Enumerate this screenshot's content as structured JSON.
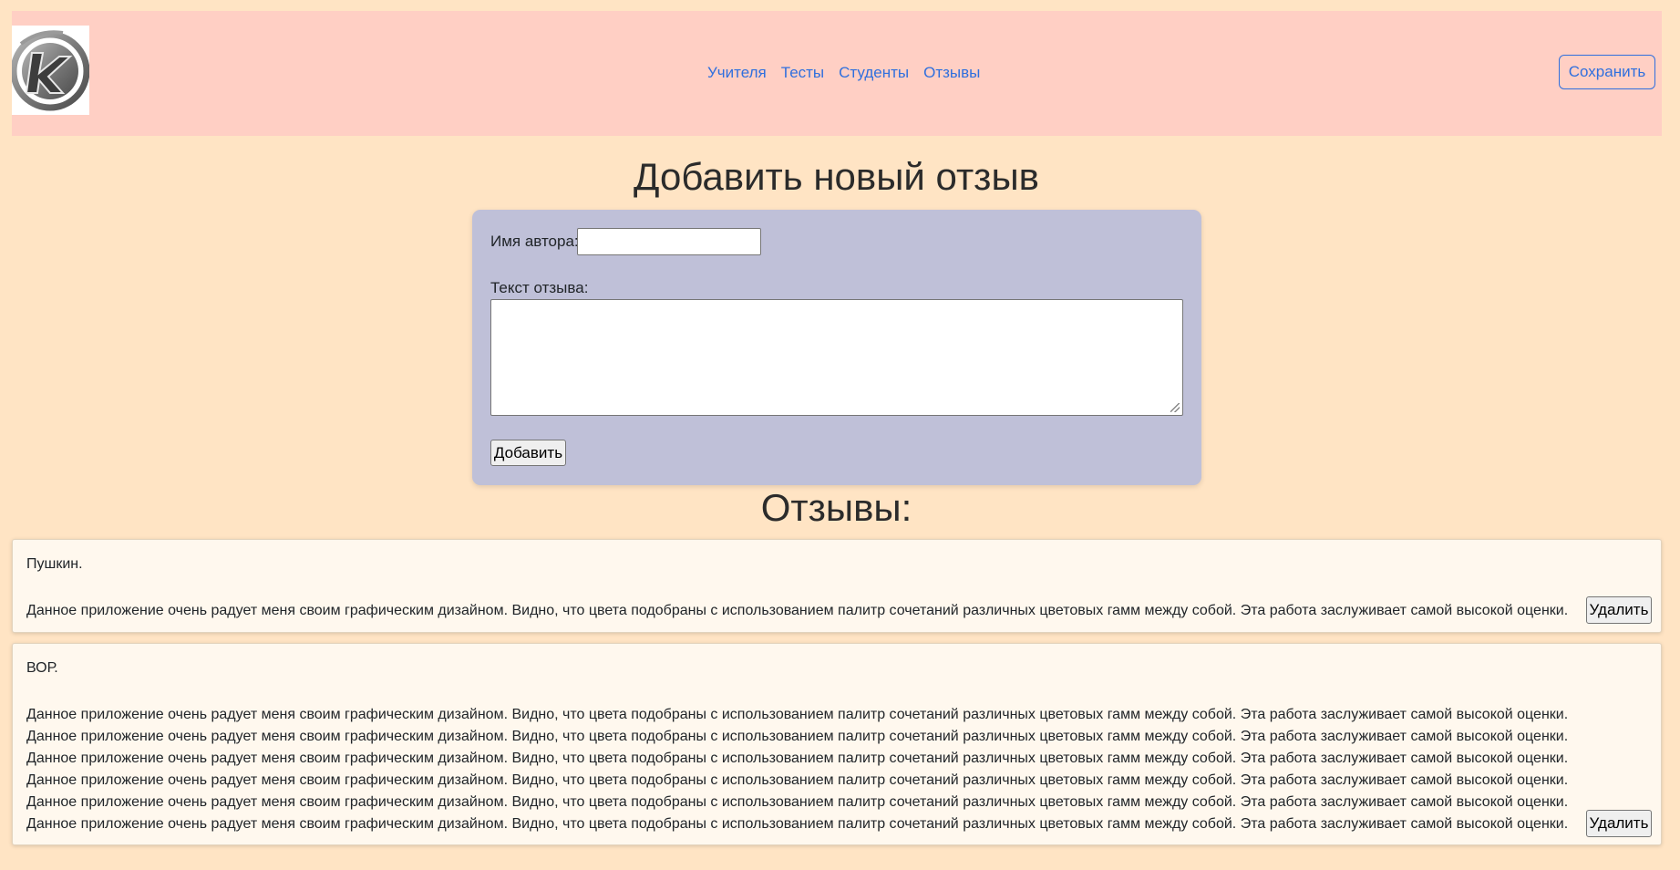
{
  "navbar": {
    "links": [
      "Учителя",
      "Тесты",
      "Студенты",
      "Отзывы"
    ],
    "save_label": "Сохранить"
  },
  "form": {
    "title": "Добавить новый отзыв",
    "author_label": "Имя автора:",
    "author_value": "",
    "text_label": "Текст отзыва:",
    "text_value": "",
    "add_label": "Добавить"
  },
  "reviews": {
    "title": "Отзывы:",
    "items": [
      {
        "author": "Пушкин.",
        "text": "Данное приложение очень радует меня своим графическим дизайном. Видно, что цвета подобраны с использованием палитр сочетаний различных цветовых гамм между собой. Эта работа заслуживает самой высокой оценки.",
        "delete_label": "Удалить"
      },
      {
        "author": "ВОР.",
        "text": "Данное приложение очень радует меня своим графическим дизайном. Видно, что цвета подобраны с использованием палитр сочетаний различных цветовых гамм между собой. Эта работа заслуживает самой высокой оценки. Данное приложение очень радует меня своим графическим дизайном. Видно, что цвета подобраны с использованием палитр сочетаний различных цветовых гамм между собой. Эта работа заслуживает самой высокой оценки. Данное приложение очень радует меня своим графическим дизайном. Видно, что цвета подобраны с использованием палитр сочетаний различных цветовых гамм между собой. Эта работа заслуживает самой высокой оценки. Данное приложение очень радует меня своим графическим дизайном. Видно, что цвета подобраны с использованием палитр сочетаний различных цветовых гамм между собой. Эта работа заслуживает самой высокой оценки. Данное приложение очень радует меня своим графическим дизайном. Видно, что цвета подобраны с использованием палитр сочетаний различных цветовых гамм между собой. Эта работа заслуживает самой высокой оценки. Данное приложение очень радует меня своим графическим дизайном. Видно, что цвета подобраны с использованием палитр сочетаний различных цветовых гамм между собой. Эта работа заслуживает самой высокой оценки.",
        "delete_label": "Удалить"
      }
    ]
  },
  "colors": {
    "page_bg": "#ffe4c4",
    "navbar_bg": "#ffcfc4",
    "link": "#2f6fde",
    "form_bg": "#bfc0d8",
    "card_bg": "#fff8ee"
  }
}
